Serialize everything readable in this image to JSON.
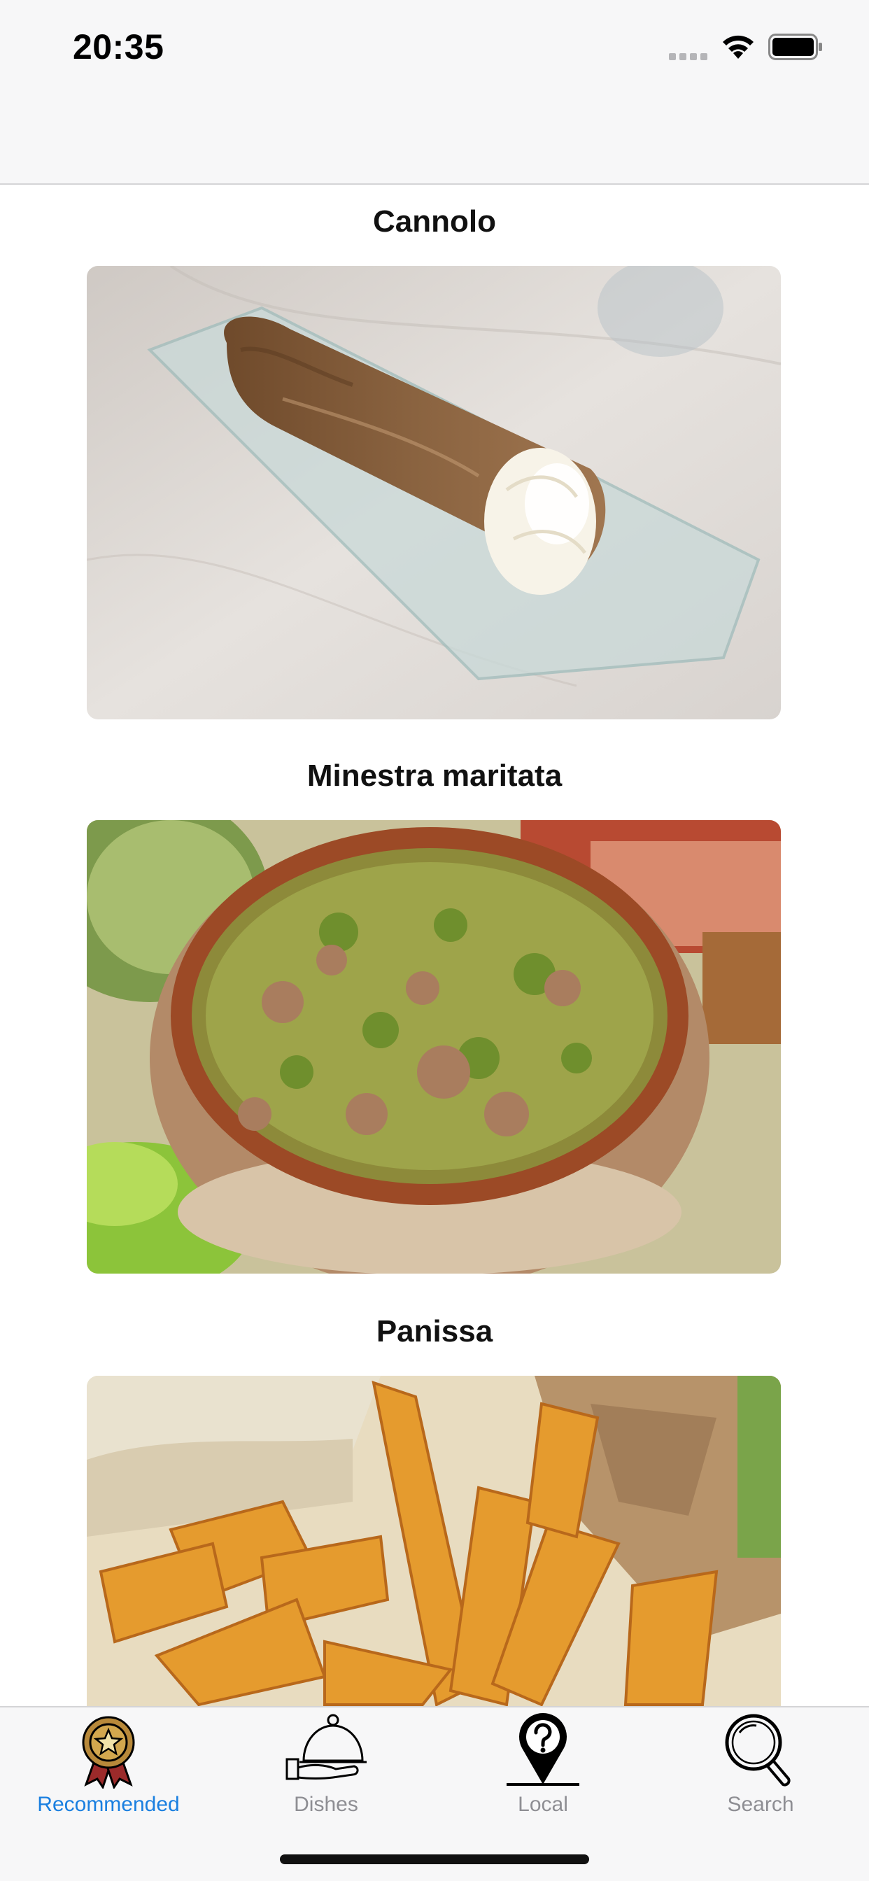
{
  "status_bar": {
    "time": "20:35"
  },
  "feed": {
    "items": [
      {
        "title": "Cannolo",
        "image": "cannolo-photo"
      },
      {
        "title": "Minestra maritata",
        "image": "minestra-maritata-photo"
      },
      {
        "title": "Panissa",
        "image": "panissa-photo"
      }
    ]
  },
  "tab_bar": {
    "active_color": "#1a7fe0",
    "inactive_color": "#8e8e93",
    "tabs": [
      {
        "label": "Recommended",
        "icon": "award-medal-icon"
      },
      {
        "label": "Dishes",
        "icon": "cloche-icon"
      },
      {
        "label": "Local",
        "icon": "location-pin-question-icon"
      },
      {
        "label": "Search",
        "icon": "magnifier-icon"
      }
    ]
  }
}
